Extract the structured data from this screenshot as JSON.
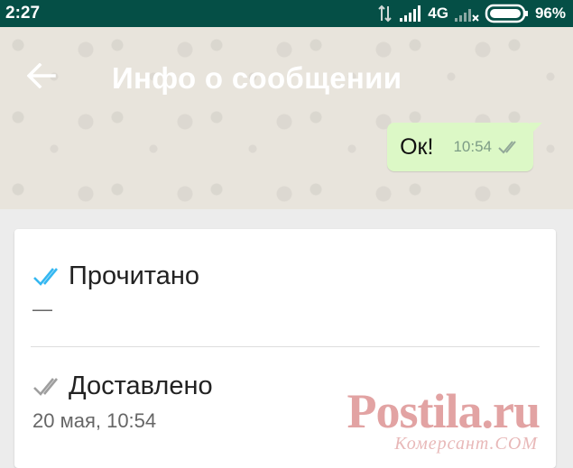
{
  "status_bar": {
    "time": "2:27",
    "network": "4G",
    "battery": "96%",
    "icons": [
      "data-arrows-icon",
      "signal-icon",
      "signal-x-icon",
      "battery-icon"
    ]
  },
  "toolbar": {
    "title": "Инфо о сообщении",
    "back_icon": "arrow-left-icon"
  },
  "message": {
    "text": "Ок!",
    "time": "10:54",
    "status_icon": "double-check-icon"
  },
  "read": {
    "label": "Прочитано",
    "value": "—",
    "icon": "double-check-blue-icon",
    "color": "#34b7f1"
  },
  "delivered": {
    "label": "Доставлено",
    "value": "20 мая, 10:54",
    "icon": "double-check-gray-icon",
    "color": "#9e9e9e"
  },
  "watermark": {
    "title": "Postila.ru",
    "subtitle": "Комерсант.COM"
  },
  "colors": {
    "status_bar": "#054f46",
    "bubble": "#dcf8c6",
    "card": "#ffffff"
  }
}
